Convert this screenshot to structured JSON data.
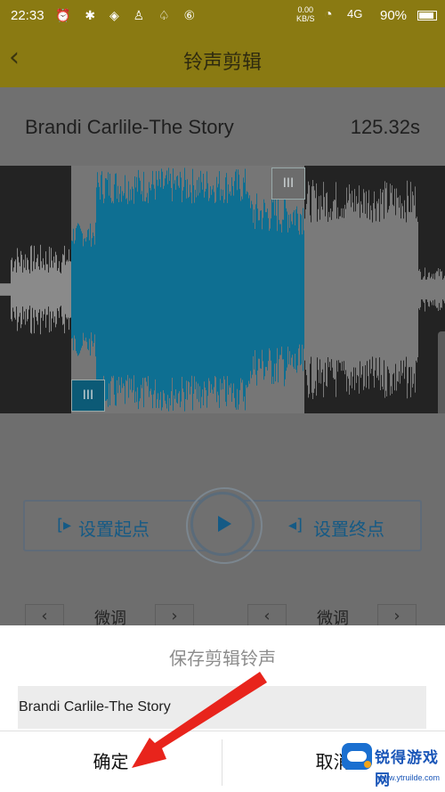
{
  "status_bar": {
    "time": "22:33",
    "left_icons_text": "⏰ ✱ ◈ ♙ ♤ ⑥",
    "speed_value": "0.00",
    "speed_unit": "KB/S",
    "network": "4G",
    "battery": "90%"
  },
  "header": {
    "back_icon": "chevron-left-icon",
    "back_glyph": "‹",
    "title": "铃声剪辑"
  },
  "song": {
    "name": "Brandi Carlile-The Story",
    "duration": "125.32s"
  },
  "waveform": {
    "selection_color": "#0e6f92",
    "unselected_color": "#7a7a7a",
    "start_handle_glyph": "III",
    "end_handle_glyph": "III"
  },
  "controls": {
    "set_start_label": "设置起点",
    "set_end_label": "设置终点",
    "set_start_icon": "[▸",
    "set_end_icon": "◂]",
    "play_icon": "play-icon",
    "fine_tune_left_label": "微调",
    "fine_tune_right_label": "微调",
    "left_arrow_glyph": "‹",
    "right_arrow_glyph": "›"
  },
  "dialog": {
    "title": "保存剪辑铃声",
    "name_value": "Brandi Carlile-The Story",
    "confirm_label": "确定",
    "cancel_label": "取消"
  },
  "watermark": {
    "brand": "锐得游戏网",
    "url": "www.ytruilde.com"
  },
  "colors": {
    "header_bg": "#8a7a12",
    "accent_blue": "#155a85",
    "annotation_arrow": "#e8241c"
  }
}
